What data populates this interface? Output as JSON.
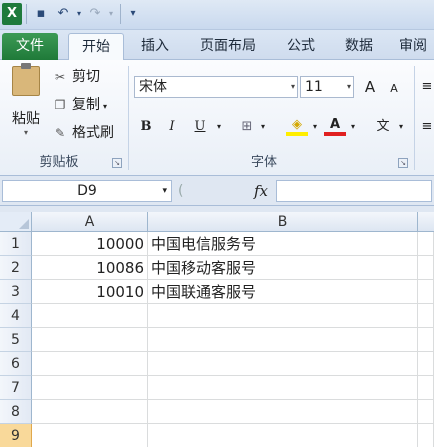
{
  "quick_access": {
    "app_icon": "X",
    "save_icon": "save-icon",
    "undo_icon": "undo-icon",
    "redo_icon": "redo-icon"
  },
  "tabs": [
    {
      "label": "文件"
    },
    {
      "label": "开始"
    },
    {
      "label": "插入"
    },
    {
      "label": "页面布局"
    },
    {
      "label": "公式"
    },
    {
      "label": "数据"
    },
    {
      "label": "审阅"
    }
  ],
  "clipboard": {
    "paste_label": "粘贴",
    "cut_label": "剪切",
    "copy_label": "复制",
    "format_painter_label": "格式刷",
    "group_label": "剪贴板"
  },
  "font": {
    "name": "宋体",
    "size": "11",
    "grow_label": "A",
    "shrink_label": "A",
    "bold": "B",
    "italic": "I",
    "underline": "U",
    "font_color_label": "A",
    "phonetic_label": "文",
    "group_label": "字体"
  },
  "formula_bar": {
    "name_box": "D9",
    "fx_label": "fx",
    "formula": ""
  },
  "sheet": {
    "columns": [
      "A",
      "B"
    ],
    "rows": [
      {
        "num": "1",
        "a": "10000",
        "b": "中国电信服务号"
      },
      {
        "num": "2",
        "a": "10086",
        "b": "中国移动客服号"
      },
      {
        "num": "3",
        "a": "10010",
        "b": "中国联通客服号"
      },
      {
        "num": "4",
        "a": "",
        "b": ""
      },
      {
        "num": "5",
        "a": "",
        "b": ""
      },
      {
        "num": "6",
        "a": "",
        "b": ""
      },
      {
        "num": "7",
        "a": "",
        "b": ""
      },
      {
        "num": "8",
        "a": "",
        "b": ""
      },
      {
        "num": "9",
        "a": "",
        "b": ""
      }
    ],
    "selected_row": "9"
  }
}
